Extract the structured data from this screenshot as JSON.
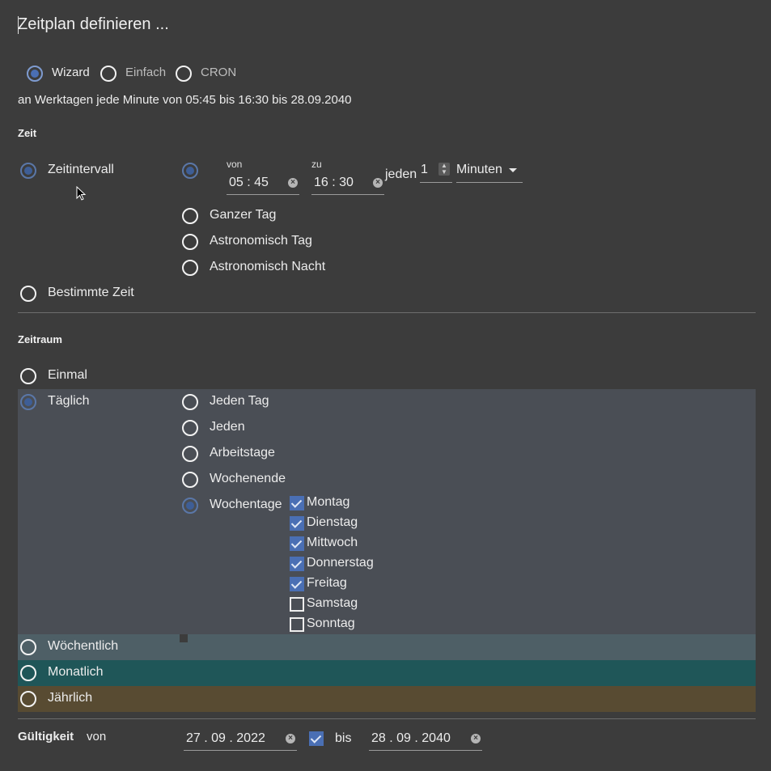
{
  "header": {
    "title": "Zeitplan definieren ..."
  },
  "mode": {
    "options": [
      "Wizard",
      "Einfach",
      "CRON"
    ],
    "selected": "Wizard",
    "summary": "an Werktagen jede Minute von 05:45 bis 16:30 bis 28.09.2040"
  },
  "zeit": {
    "title": "Zeit",
    "type_options": [
      "Zeitintervall",
      "Bestimmte Zeit"
    ],
    "selected_type": "Zeitintervall",
    "interval": {
      "von_label": "von",
      "von_value": "05 : 45",
      "zu_label": "zu",
      "zu_value": "16 : 30",
      "jeden_label": "jeden",
      "jeden_value": "1",
      "unit_value": "Minuten"
    },
    "range_options": [
      "Ganzer Tag",
      "Astronomisch Tag",
      "Astronomisch Nacht"
    ]
  },
  "zeitraum": {
    "title": "Zeitraum",
    "options": [
      "Einmal",
      "Täglich",
      "Wöchentlich",
      "Monatlich",
      "Jährlich"
    ],
    "selected": "Täglich",
    "daily_options": [
      "Jeden Tag",
      "Jeden",
      "Arbeitstage",
      "Wochenende",
      "Wochentage"
    ],
    "daily_selected": "Wochentage",
    "weekdays": [
      {
        "label": "Montag",
        "checked": true
      },
      {
        "label": "Dienstag",
        "checked": true
      },
      {
        "label": "Mittwoch",
        "checked": true
      },
      {
        "label": "Donnerstag",
        "checked": true
      },
      {
        "label": "Freitag",
        "checked": true
      },
      {
        "label": "Samstag",
        "checked": false
      },
      {
        "label": "Sonntag",
        "checked": false
      }
    ]
  },
  "validity": {
    "title": "Gültigkeit",
    "von_label": "von",
    "von_value": "27 . 09 . 2022",
    "bis_label": "bis",
    "bis_checked": true,
    "bis_value": "28 . 09 . 2040"
  },
  "colors": {
    "background": "#3c3c3c",
    "accent": "#4a6fb4",
    "daily_band": "#4a4e55",
    "weekly_band": "#4e5f66",
    "monthly_band": "#1f5658",
    "yearly_band": "#584b32"
  }
}
